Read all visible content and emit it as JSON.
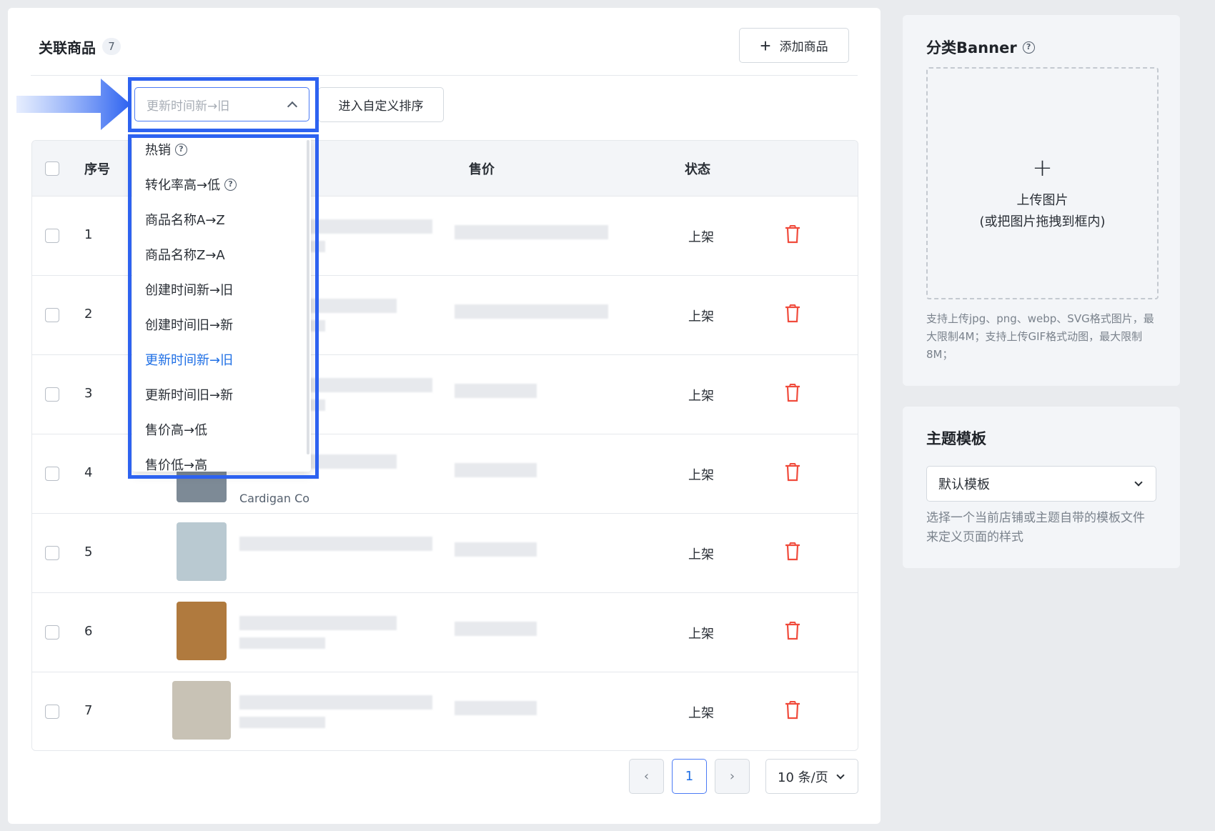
{
  "products": {
    "title": "关联商品",
    "count": "7",
    "add_label": "添加商品",
    "sort_selected": "更新时间新→旧",
    "custom_sort_label": "进入自定义排序",
    "columns": {
      "index": "序号",
      "price": "售价",
      "status": "状态"
    },
    "rows": [
      {
        "index": "1",
        "status": "上架"
      },
      {
        "index": "2",
        "status": "上架"
      },
      {
        "index": "3",
        "status": "上架"
      },
      {
        "index": "4",
        "status": "上架",
        "name_partial": "Cardigan Co"
      },
      {
        "index": "5",
        "status": "上架"
      },
      {
        "index": "6",
        "status": "上架"
      },
      {
        "index": "7",
        "status": "上架"
      }
    ]
  },
  "sort_options": [
    {
      "label": "热销",
      "help": true
    },
    {
      "label": "转化率高→低",
      "help": true
    },
    {
      "label": "商品名称A→Z"
    },
    {
      "label": "商品名称Z→A"
    },
    {
      "label": "创建时间新→旧"
    },
    {
      "label": "创建时间旧→新"
    },
    {
      "label": "更新时间新→旧",
      "active": true
    },
    {
      "label": "更新时间旧→新"
    },
    {
      "label": "售价高→低"
    },
    {
      "label": "售价低→高"
    }
  ],
  "pagination": {
    "current": "1",
    "per_page": "10 条/页"
  },
  "banner": {
    "title": "分类Banner",
    "upload_label": "上传图片",
    "upload_sub": "(或把图片拖拽到框内)",
    "hint": "支持上传jpg、png、webp、SVG格式图片，最大限制4M；支持上传GIF格式动图，最大限制8M；"
  },
  "theme": {
    "title": "主题模板",
    "selected": "默认模板",
    "hint": "选择一个当前店铺或主题自带的模板文件来定义页面的样式"
  },
  "colors": {
    "accent": "#1f6fe5",
    "highlight": "#2d62f0",
    "danger": "#f04b3c"
  }
}
